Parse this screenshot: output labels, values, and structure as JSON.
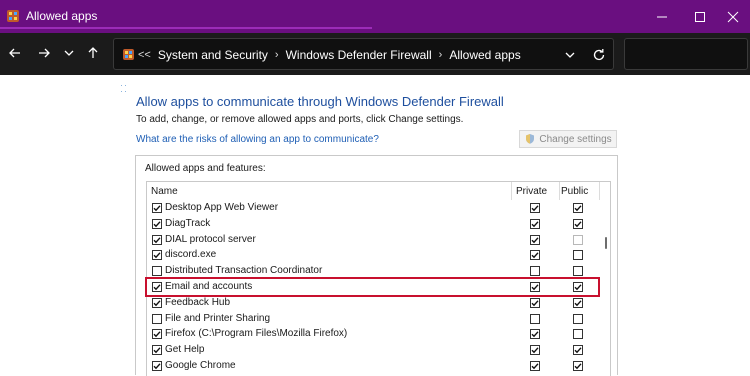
{
  "window": {
    "title": "Allowed apps",
    "controls": [
      "minimize",
      "maximize",
      "close"
    ]
  },
  "nav": {
    "back_icon": "back-arrow-icon",
    "forward_icon": "forward-arrow-icon",
    "recent_icon": "chevron-down-icon",
    "up_icon": "up-arrow-icon"
  },
  "address": {
    "overflow": "<<",
    "crumbs": [
      "System and Security",
      "Windows Defender Firewall",
      "Allowed apps"
    ],
    "search_placeholder": ""
  },
  "main": {
    "heading": "Allow apps to communicate through Windows Defender Firewall",
    "subtitle": "To add, change, or remove allowed apps and ports, click Change settings.",
    "risk_link": "What are the risks of allowing an app to communicate?",
    "change_settings": "Change settings",
    "panel_label": "Allowed apps and features:",
    "columns": {
      "name": "Name",
      "private": "Private",
      "public": "Public"
    },
    "rows": [
      {
        "name": "Desktop App Web Viewer",
        "enabled": true,
        "private": true,
        "public": true,
        "public_dim": false
      },
      {
        "name": "DiagTrack",
        "enabled": true,
        "private": true,
        "public": true,
        "public_dim": false
      },
      {
        "name": "DIAL protocol server",
        "enabled": true,
        "private": true,
        "public": false,
        "public_dim": true
      },
      {
        "name": "discord.exe",
        "enabled": true,
        "private": true,
        "public": false,
        "public_dim": false
      },
      {
        "name": "Distributed Transaction Coordinator",
        "enabled": false,
        "private": false,
        "public": false,
        "public_dim": false
      },
      {
        "name": "Email and accounts",
        "enabled": true,
        "private": true,
        "public": true,
        "public_dim": false
      },
      {
        "name": "Feedback Hub",
        "enabled": true,
        "private": true,
        "public": true,
        "public_dim": false
      },
      {
        "name": "File and Printer Sharing",
        "enabled": false,
        "private": false,
        "public": false,
        "public_dim": false
      },
      {
        "name": "Firefox (C:\\Program Files\\Mozilla Firefox)",
        "enabled": true,
        "private": true,
        "public": false,
        "public_dim": false
      },
      {
        "name": "Get Help",
        "enabled": true,
        "private": true,
        "public": true,
        "public_dim": false
      },
      {
        "name": "Google Chrome",
        "enabled": true,
        "private": true,
        "public": true,
        "public_dim": false
      }
    ],
    "highlighted_row": "Email and accounts"
  },
  "colors": {
    "titlebar": "#6a0f80",
    "addressbar": "#1b1b1b",
    "heading": "#1e4f9e",
    "link": "#1f5fb5",
    "highlight": "#c8102e"
  }
}
